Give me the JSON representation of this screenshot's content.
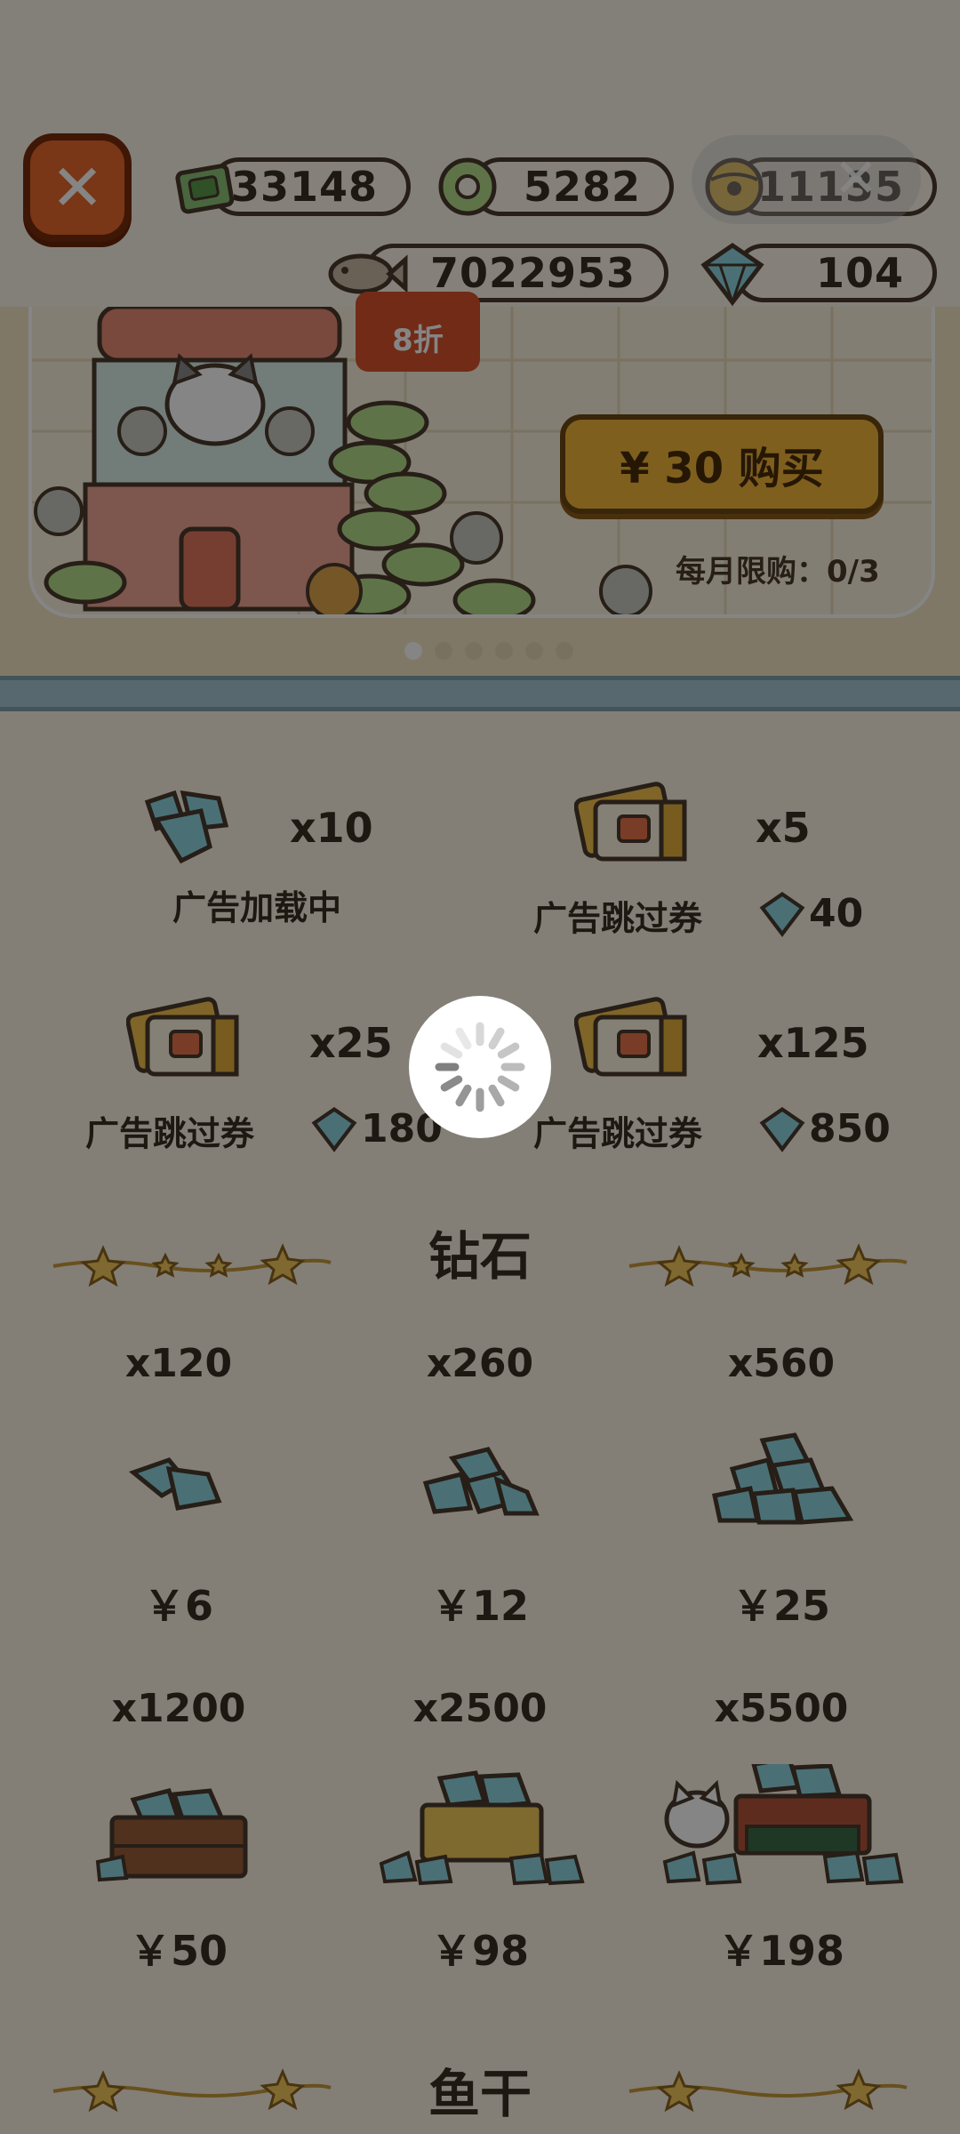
{
  "header": {
    "currencies": [
      {
        "icon": "cash-icon",
        "value": "33148"
      },
      {
        "icon": "coin-ring-icon",
        "value": "5282"
      },
      {
        "icon": "bell-coin-icon",
        "value": "11135"
      },
      {
        "icon": "fish-icon",
        "value": "7022953"
      },
      {
        "icon": "diamond-icon",
        "value": "104"
      }
    ]
  },
  "banner": {
    "discount": "8折",
    "buy_label": "¥ 30 购买",
    "monthly_limit": "每月限购：0/3",
    "page_count": 6,
    "active_page": 0
  },
  "shop": {
    "items": [
      {
        "qty": "x10",
        "label": "广告加载中",
        "price": ""
      },
      {
        "qty": "x5",
        "label": "广告跳过券",
        "price": "40"
      },
      {
        "qty": "x25",
        "label": "广告跳过券",
        "price": "180"
      },
      {
        "qty": "x125",
        "label": "广告跳过券",
        "price": "850"
      }
    ]
  },
  "diamonds": {
    "title": "钻石",
    "packs": [
      {
        "qty": "x120",
        "price": "￥6"
      },
      {
        "qty": "x260",
        "price": "￥12"
      },
      {
        "qty": "x560",
        "price": "￥25"
      },
      {
        "qty": "x1200",
        "price": "￥50"
      },
      {
        "qty": "x2500",
        "price": "￥98"
      },
      {
        "qty": "x5500",
        "price": "￥198"
      }
    ]
  },
  "next_section": {
    "title": "鱼干"
  },
  "colors": {
    "accent_orange": "#e86a2d",
    "gem_blue": "#6fc6d8",
    "outline_brown": "#4a3b2d",
    "card_bg": "#fbf3e2",
    "buy_gold": "#f3b73a"
  }
}
